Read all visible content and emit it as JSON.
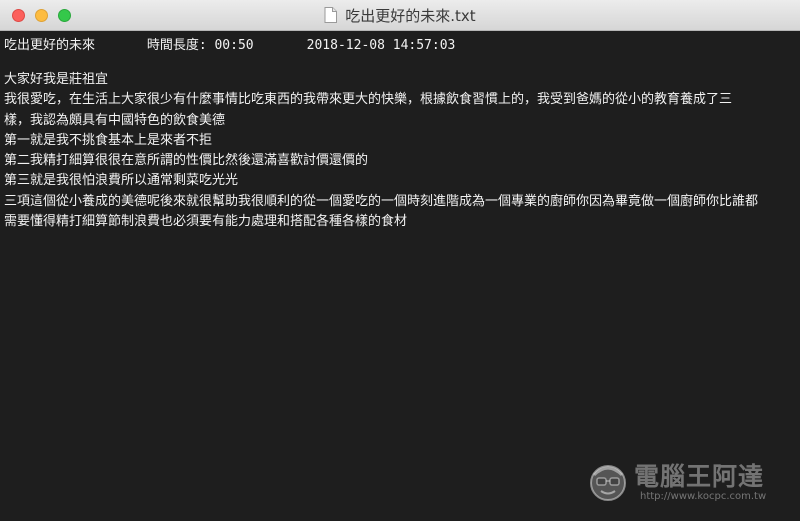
{
  "window": {
    "title": "吃出更好的未來.txt"
  },
  "header": {
    "file_title": "吃出更好的未來",
    "duration_label": "時間長度: 00:50",
    "timestamp": "2018-12-08 14:57:03"
  },
  "lines": [
    "大家好我是莊祖宜",
    "我很愛吃，在生活上大家很少有什麼事情比吃東西的我帶來更大的快樂，根據飲食習慣上的，我受到爸媽的從小的教育養成了三",
    "樣，我認為頗具有中國特色的飲食美德",
    "第一就是我不挑食基本上是來者不拒",
    "第二我精打細算很很在意所謂的性價比然後還滿喜歡討價還價的",
    "第三就是我很怕浪費所以通常剩菜吃光光",
    "三項這個從小養成的美德呢後來就很幫助我很順利的從一個愛吃的一個時刻進階成為一個專業的廚師你因為畢竟做一個廚師你比誰都",
    "需要懂得精打細算節制浪費也必須要有能力處理和搭配各種各樣的食材"
  ],
  "watermark": {
    "brand": "電腦王阿達",
    "url": "http://www.kocpc.com.tw"
  },
  "colors": {
    "background": "#1e1e1e",
    "text": "#f2f2f2",
    "close": "#fc605c",
    "minimize": "#fdbc40",
    "maximize": "#34c84a"
  }
}
